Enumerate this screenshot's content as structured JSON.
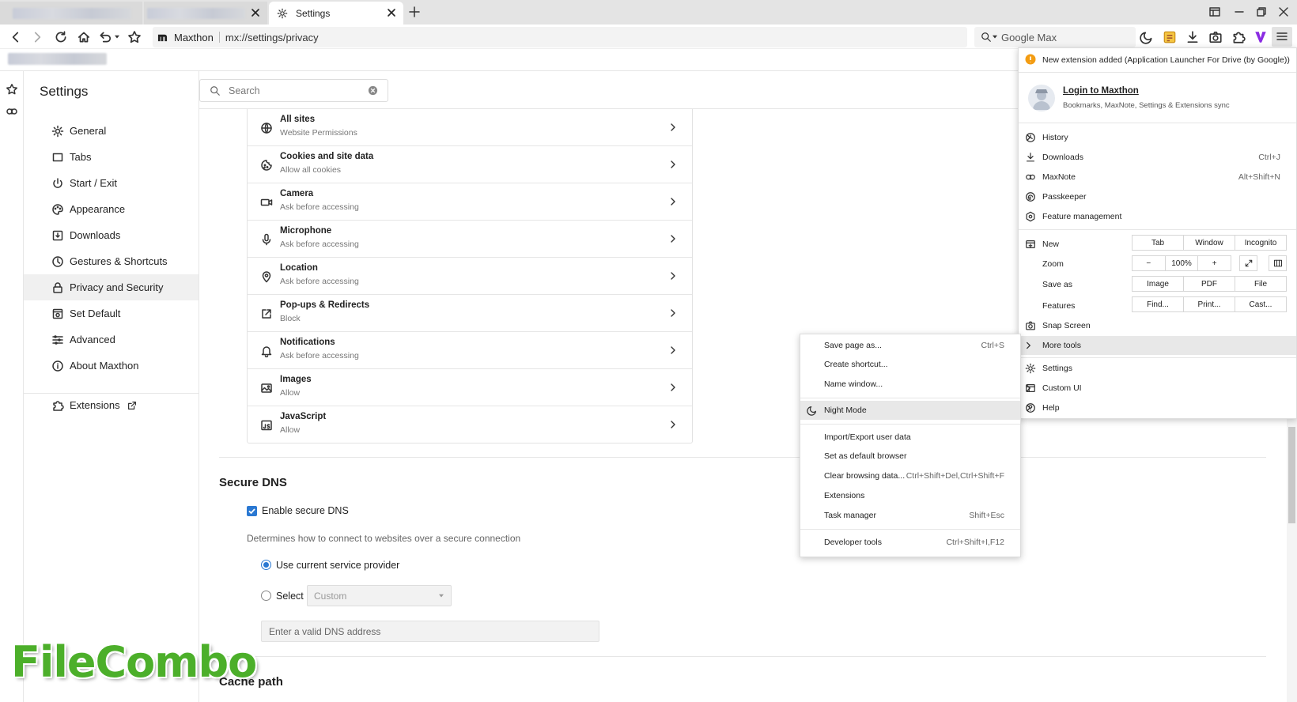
{
  "tabs": {
    "active_label": "Settings"
  },
  "address": {
    "site_name": "Maxthon",
    "url": "mx://settings/privacy",
    "search_engine": "Google Max"
  },
  "settings": {
    "title": "Settings",
    "search_placeholder": "Search",
    "nav": [
      {
        "label": "General",
        "icon": "gear-icon"
      },
      {
        "label": "Tabs",
        "icon": "tabs-icon"
      },
      {
        "label": "Start / Exit",
        "icon": "power-icon"
      },
      {
        "label": "Appearance",
        "icon": "palette-icon"
      },
      {
        "label": "Downloads",
        "icon": "download-icon"
      },
      {
        "label": "Gestures & Shortcuts",
        "icon": "gesture-icon"
      },
      {
        "label": "Privacy and Security",
        "icon": "lock-icon",
        "selected": true
      },
      {
        "label": "Set Default",
        "icon": "browser-icon"
      },
      {
        "label": "Advanced",
        "icon": "sliders-icon"
      },
      {
        "label": "About Maxthon",
        "icon": "info-icon"
      }
    ],
    "extensions_label": "Extensions"
  },
  "permissions": [
    {
      "title": "All sites",
      "subtitle": "Website Permissions",
      "icon": "globe-icon"
    },
    {
      "title": "Cookies and site data",
      "subtitle": "Allow all cookies",
      "icon": "cookie-icon"
    },
    {
      "title": "Camera",
      "subtitle": "Ask before accessing",
      "icon": "camera-icon"
    },
    {
      "title": "Microphone",
      "subtitle": "Ask before accessing",
      "icon": "microphone-icon"
    },
    {
      "title": "Location",
      "subtitle": "Ask before accessing",
      "icon": "location-icon"
    },
    {
      "title": "Pop-ups & Redirects",
      "subtitle": "Block",
      "icon": "popup-icon"
    },
    {
      "title": "Notifications",
      "subtitle": "Ask before accessing",
      "icon": "bell-icon"
    },
    {
      "title": "Images",
      "subtitle": "Allow",
      "icon": "image-icon"
    },
    {
      "title": "JavaScript",
      "subtitle": "Allow",
      "icon": "code-icon"
    }
  ],
  "secure_dns": {
    "title": "Secure DNS",
    "enable_label": "Enable secure DNS",
    "enabled": true,
    "description": "Determines how to connect to websites over a secure connection",
    "option_current": "Use current service provider",
    "option_select": "Select",
    "select_value": "Custom",
    "dns_placeholder": "Enter a valid DNS address"
  },
  "cache": {
    "title": "Cache path"
  },
  "main_menu": {
    "notification": "New extension added (Application Launcher For Drive (by Google))",
    "login_title": "Login to Maxthon",
    "login_subtitle": "Bookmarks, MaxNote, Settings & Extensions sync",
    "history": "History",
    "downloads": "Downloads",
    "downloads_shortcut": "Ctrl+J",
    "maxnote": "MaxNote",
    "maxnote_shortcut": "Alt+Shift+N",
    "passkeeper": "Passkeeper",
    "feature_management": "Feature management",
    "new_label": "New",
    "new_options": [
      "Tab",
      "Window",
      "Incognito"
    ],
    "zoom_label": "Zoom",
    "zoom_minus": "−",
    "zoom_value": "100%",
    "zoom_plus": "+",
    "save_as_label": "Save as",
    "save_as_options": [
      "Image",
      "PDF",
      "File"
    ],
    "features_label": "Features",
    "features_options": [
      "Find...",
      "Print...",
      "Cast..."
    ],
    "snap_screen": "Snap Screen",
    "more_tools": "More tools",
    "settings": "Settings",
    "custom_ui": "Custom UI",
    "help": "Help"
  },
  "more_tools_menu": [
    {
      "label": "Save page as...",
      "shortcut": "Ctrl+S"
    },
    {
      "label": "Create shortcut...",
      "shortcut": ""
    },
    {
      "label": "Name window...",
      "shortcut": ""
    },
    {
      "label": "Night Mode",
      "shortcut": ""
    },
    {
      "label": "Import/Export user data",
      "shortcut": ""
    },
    {
      "label": "Set as default browser",
      "shortcut": ""
    },
    {
      "label": "Clear browsing data...",
      "shortcut": "Ctrl+Shift+Del,Ctrl+Shift+F"
    },
    {
      "label": "Extensions",
      "shortcut": ""
    },
    {
      "label": "Task manager",
      "shortcut": "Shift+Esc"
    },
    {
      "label": "Developer tools",
      "shortcut": "Ctrl+Shift+I,F12"
    }
  ],
  "watermark": "FileCombo",
  "colors": {
    "accent": "#2a78d2",
    "warning": "#f39c12",
    "maxthon_v": "#8a2be2",
    "watermark_green": "#4caf2a"
  }
}
